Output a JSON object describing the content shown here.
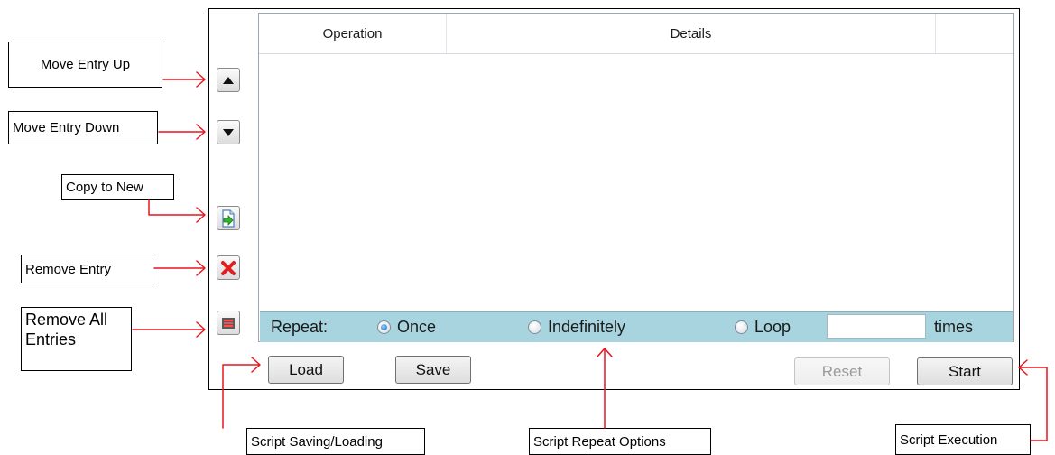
{
  "annotations": {
    "move_up": "Move Entry Up",
    "move_down": "Move Entry Down",
    "copy_to_new": "Copy to New",
    "remove_entry": "Remove Entry",
    "remove_all": "Remove All Entries",
    "saving_loading": "Script Saving/Loading",
    "repeat_options": "Script Repeat Options",
    "execution": "Script Execution"
  },
  "side_buttons": [
    {
      "name": "move-up",
      "icon": "triangle-up-icon"
    },
    {
      "name": "move-down",
      "icon": "triangle-down-icon"
    },
    {
      "name": "copy-to-new",
      "icon": "copy-document-icon"
    },
    {
      "name": "remove-entry",
      "icon": "red-x-icon"
    },
    {
      "name": "remove-all",
      "icon": "clear-all-icon"
    }
  ],
  "list": {
    "columns": [
      "Operation",
      "Details",
      ""
    ]
  },
  "repeat": {
    "label": "Repeat:",
    "options": [
      "Once",
      "Indefinitely",
      "Loop"
    ],
    "selected": "Once",
    "loop_count": "",
    "times_label": "times"
  },
  "actions": {
    "load": "Load",
    "save": "Save",
    "reset": "Reset",
    "start": "Start",
    "reset_enabled": false
  },
  "colors": {
    "arrow": "#e8141c",
    "repeat_bar": "#a8d4e0",
    "remove_red": "#e02020"
  }
}
